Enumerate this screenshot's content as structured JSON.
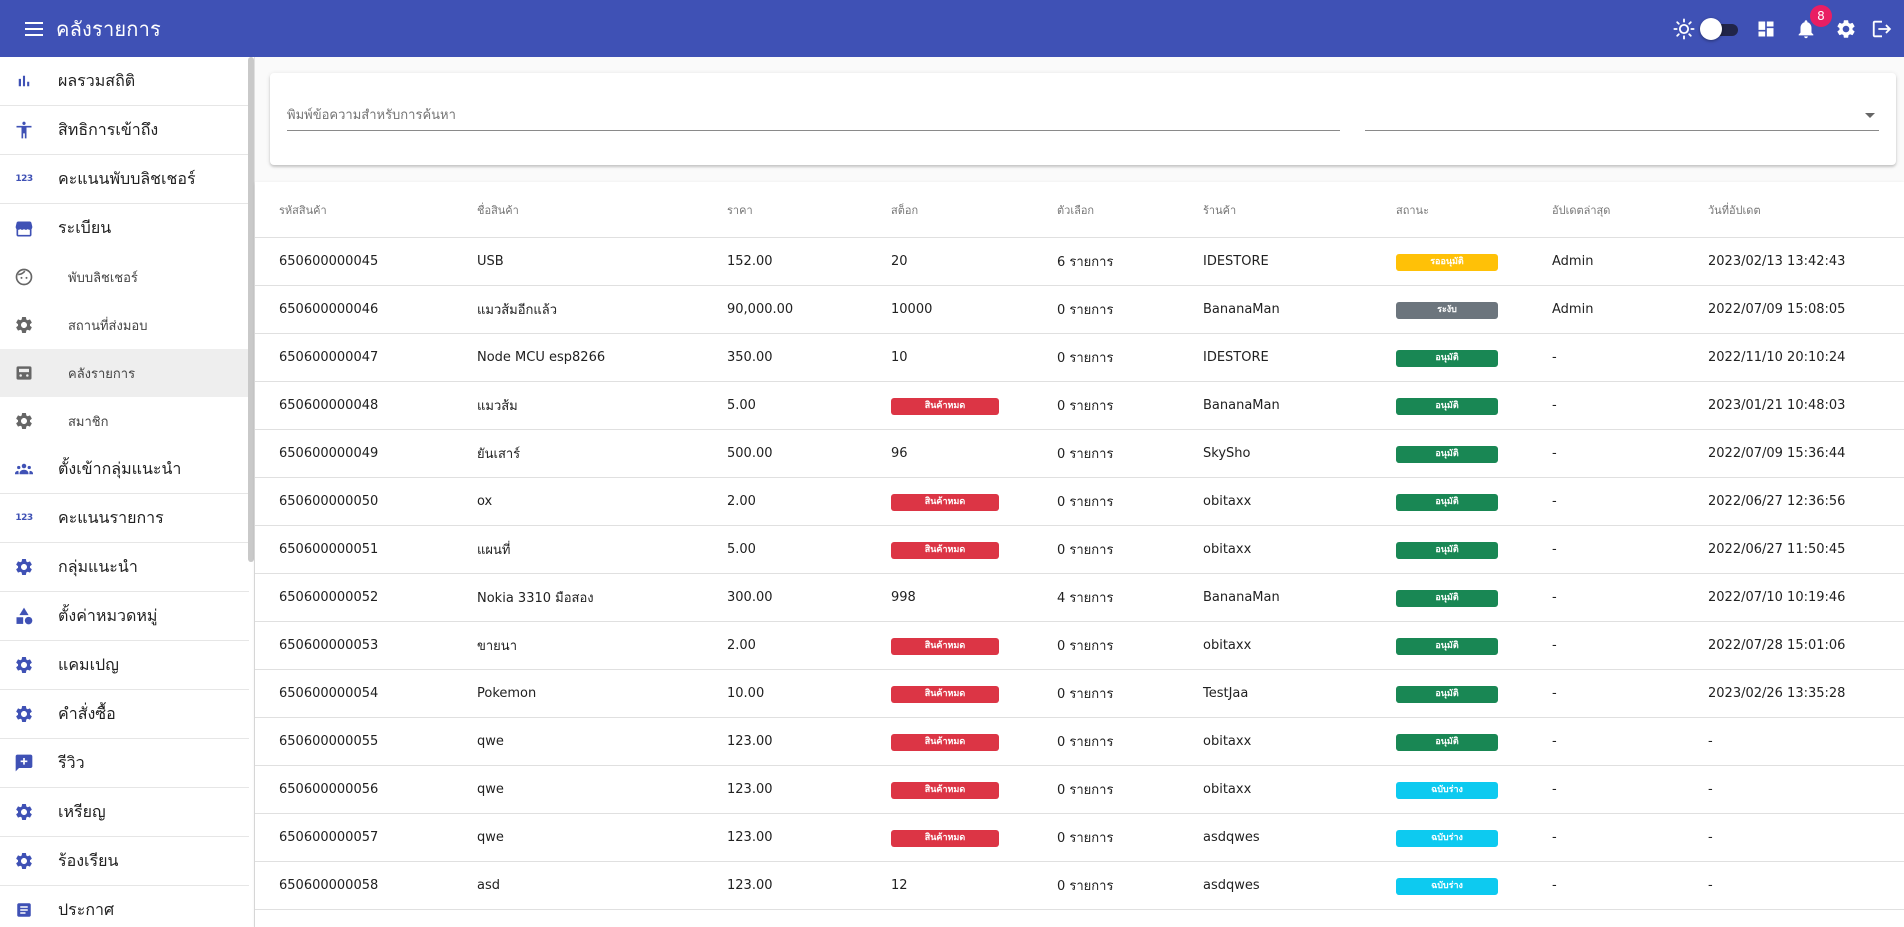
{
  "appbar": {
    "title": "คลังรายการ",
    "notification_count": "8",
    "color": "#3f51b5"
  },
  "sidebar": {
    "items": [
      {
        "label": "ผลรวมสถิติ",
        "icon": "bar-chart-icon",
        "type": "main"
      },
      {
        "label": "สิทธิการเข้าถึง",
        "icon": "accessibility-icon",
        "type": "main"
      },
      {
        "label": "คะแนนพับบลิชเชอร์",
        "icon": "numbers-icon",
        "type": "main"
      },
      {
        "label": "ระเบียน",
        "icon": "storefront-icon",
        "type": "group"
      },
      {
        "label": "พับบลิชเชอร์",
        "icon": "face-icon",
        "type": "sub"
      },
      {
        "label": "สถานที่ส่งมอบ",
        "icon": "gear-icon",
        "type": "sub"
      },
      {
        "label": "คลังรายการ",
        "icon": "inventory-icon",
        "type": "sub",
        "active": true
      },
      {
        "label": "สมาชิก",
        "icon": "gear-icon",
        "type": "sub"
      },
      {
        "label": "ตั้งเข้ากลุ่มแนะนำ",
        "icon": "groups-icon",
        "type": "main"
      },
      {
        "label": "คะแนนรายการ",
        "icon": "numbers-icon",
        "type": "main"
      },
      {
        "label": "กลุ่มแนะนำ",
        "icon": "gear-icon",
        "type": "main"
      },
      {
        "label": "ตั้งค่าหมวดหมู่",
        "icon": "category-icon",
        "type": "main"
      },
      {
        "label": "แคมเปญ",
        "icon": "gear-icon",
        "type": "main"
      },
      {
        "label": "คำสั่งซื้อ",
        "icon": "gear-icon",
        "type": "main"
      },
      {
        "label": "รีวิว",
        "icon": "rate-review-icon",
        "type": "main"
      },
      {
        "label": "เหรียญ",
        "icon": "gear-icon",
        "type": "main"
      },
      {
        "label": "ร้องเรียน",
        "icon": "gear-icon",
        "type": "main"
      },
      {
        "label": "ประกาศ",
        "icon": "article-icon",
        "type": "main"
      }
    ]
  },
  "filters": {
    "search_placeholder": "พิมพ์ข้อความสำหรับการค้นหา",
    "select_value": ""
  },
  "table": {
    "headers": [
      "รหัสสินค้า",
      "ชื่อสินค้า",
      "ราคา",
      "สต็อก",
      "ตัวเลือก",
      "ร้านค้า",
      "สถานะ",
      "อัปเดตล่าสุด",
      "วันที่อัปเดต"
    ],
    "rows": [
      {
        "code": "650600000045",
        "name": "USB",
        "price": "152.00",
        "stock": "20",
        "stock_out": false,
        "options": "6 รายการ",
        "shop": "IDESTORE",
        "status": "รออนุมัติ",
        "status_color": "#ffc107",
        "updated_by": "Admin",
        "updated_at": "2023/02/13 13:42:43"
      },
      {
        "code": "650600000046",
        "name": "แมวส้มอีกแล้ว",
        "price": "90,000.00",
        "stock": "10000",
        "stock_out": false,
        "options": "0 รายการ",
        "shop": "BananaMan",
        "status": "ระงับ",
        "status_color": "#6c757d",
        "updated_by": "Admin",
        "updated_at": "2022/07/09 15:08:05"
      },
      {
        "code": "650600000047",
        "name": "Node MCU esp8266",
        "price": "350.00",
        "stock": "10",
        "stock_out": false,
        "options": "0 รายการ",
        "shop": "IDESTORE",
        "status": "อนุมัติ",
        "status_color": "#198754",
        "updated_by": "-",
        "updated_at": "2022/11/10 20:10:24"
      },
      {
        "code": "650600000048",
        "name": "แมวส้ม",
        "price": "5.00",
        "stock": "สินค้าหมด",
        "stock_out": true,
        "options": "0 รายการ",
        "shop": "BananaMan",
        "status": "อนุมัติ",
        "status_color": "#198754",
        "updated_by": "-",
        "updated_at": "2023/01/21 10:48:03"
      },
      {
        "code": "650600000049",
        "name": "ยันเสาร์",
        "price": "500.00",
        "stock": "96",
        "stock_out": false,
        "options": "0 รายการ",
        "shop": "SkySho",
        "status": "อนุมัติ",
        "status_color": "#198754",
        "updated_by": "-",
        "updated_at": "2022/07/09 15:36:44"
      },
      {
        "code": "650600000050",
        "name": "ox",
        "price": "2.00",
        "stock": "สินค้าหมด",
        "stock_out": true,
        "options": "0 รายการ",
        "shop": "obitaxx",
        "status": "อนุมัติ",
        "status_color": "#198754",
        "updated_by": "-",
        "updated_at": "2022/06/27 12:36:56"
      },
      {
        "code": "650600000051",
        "name": "แผนที่",
        "price": "5.00",
        "stock": "สินค้าหมด",
        "stock_out": true,
        "options": "0 รายการ",
        "shop": "obitaxx",
        "status": "อนุมัติ",
        "status_color": "#198754",
        "updated_by": "-",
        "updated_at": "2022/06/27 11:50:45"
      },
      {
        "code": "650600000052",
        "name": "Nokia 3310 มือสอง",
        "price": "300.00",
        "stock": "998",
        "stock_out": false,
        "options": "4 รายการ",
        "shop": "BananaMan",
        "status": "อนุมัติ",
        "status_color": "#198754",
        "updated_by": "-",
        "updated_at": "2022/07/10 10:19:46"
      },
      {
        "code": "650600000053",
        "name": "ขายนา",
        "price": "2.00",
        "stock": "สินค้าหมด",
        "stock_out": true,
        "options": "0 รายการ",
        "shop": "obitaxx",
        "status": "อนุมัติ",
        "status_color": "#198754",
        "updated_by": "-",
        "updated_at": "2022/07/28 15:01:06"
      },
      {
        "code": "650600000054",
        "name": "Pokemon",
        "price": "10.00",
        "stock": "สินค้าหมด",
        "stock_out": true,
        "options": "0 รายการ",
        "shop": "TestJaa",
        "status": "อนุมัติ",
        "status_color": "#198754",
        "updated_by": "-",
        "updated_at": "2023/02/26 13:35:28"
      },
      {
        "code": "650600000055",
        "name": "qwe",
        "price": "123.00",
        "stock": "สินค้าหมด",
        "stock_out": true,
        "options": "0 รายการ",
        "shop": "obitaxx",
        "status": "อนุมัติ",
        "status_color": "#198754",
        "updated_by": "-",
        "updated_at": "-"
      },
      {
        "code": "650600000056",
        "name": "qwe",
        "price": "123.00",
        "stock": "สินค้าหมด",
        "stock_out": true,
        "options": "0 รายการ",
        "shop": "obitaxx",
        "status": "ฉบับร่าง",
        "status_color": "#0dcaf0",
        "updated_by": "-",
        "updated_at": "-"
      },
      {
        "code": "650600000057",
        "name": "qwe",
        "price": "123.00",
        "stock": "สินค้าหมด",
        "stock_out": true,
        "options": "0 รายการ",
        "shop": "asdqwes",
        "status": "ฉบับร่าง",
        "status_color": "#0dcaf0",
        "updated_by": "-",
        "updated_at": "-"
      },
      {
        "code": "650600000058",
        "name": "asd",
        "price": "123.00",
        "stock": "12",
        "stock_out": false,
        "options": "0 รายการ",
        "shop": "asdqwes",
        "status": "ฉบับร่าง",
        "status_color": "#0dcaf0",
        "updated_by": "-",
        "updated_at": "-"
      }
    ]
  }
}
